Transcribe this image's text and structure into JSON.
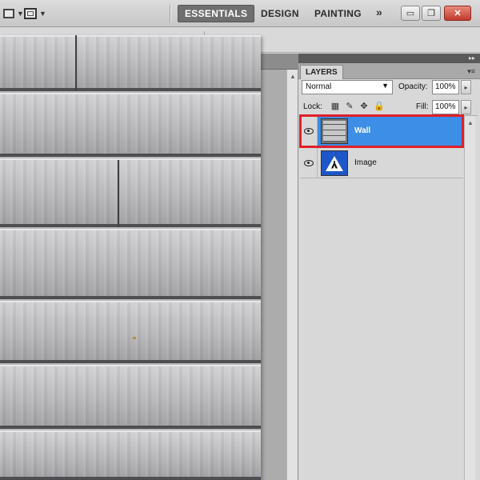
{
  "toolbar": {
    "workspaces": [
      {
        "label": "ESSENTIALS",
        "active": true
      },
      {
        "label": "DESIGN",
        "active": false
      },
      {
        "label": "PAINTING",
        "active": false
      }
    ],
    "more_icon": "double-chevron-right-icon",
    "window_buttons": [
      {
        "icon": "minimize-icon",
        "glyph": "▭"
      },
      {
        "icon": "restore-icon",
        "glyph": "❐"
      },
      {
        "icon": "close-icon",
        "glyph": "✕"
      }
    ]
  },
  "layers_panel": {
    "tab_label": "LAYERS",
    "blend_mode": "Normal",
    "opacity_label": "Opacity:",
    "opacity_value": "100%",
    "lock_label": "Lock:",
    "fill_label": "Fill:",
    "fill_value": "100%",
    "lock_icons": [
      "lock-transparent-icon",
      "lock-brush-icon",
      "lock-move-icon",
      "lock-all-icon"
    ],
    "layers": [
      {
        "name": "Wall",
        "selected": true,
        "visible": true,
        "thumbnail": "wall-texture"
      },
      {
        "name": "Image",
        "selected": false,
        "visible": true,
        "thumbnail": "pedestrian-crossing-sign"
      }
    ]
  },
  "colors": {
    "selection_blue": "#3d8ee6",
    "highlight_red": "#e0202a",
    "sign_blue": "#1d56c6"
  }
}
